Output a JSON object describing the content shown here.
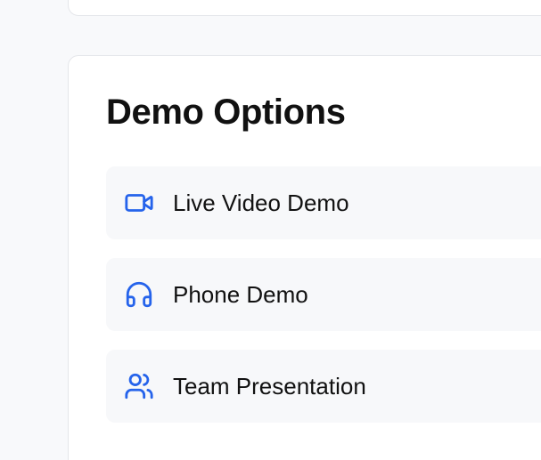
{
  "section": {
    "title": "Demo Options"
  },
  "options": [
    {
      "label": "Live Video Demo",
      "icon": "video-camera-icon"
    },
    {
      "label": "Phone Demo",
      "icon": "headphones-icon"
    },
    {
      "label": "Team Presentation",
      "icon": "users-icon"
    }
  ],
  "colors": {
    "accent": "#2563eb",
    "page_background": "#f8f9fb",
    "card_background": "#ffffff",
    "option_background": "#f7f8fa",
    "text": "#111111"
  }
}
